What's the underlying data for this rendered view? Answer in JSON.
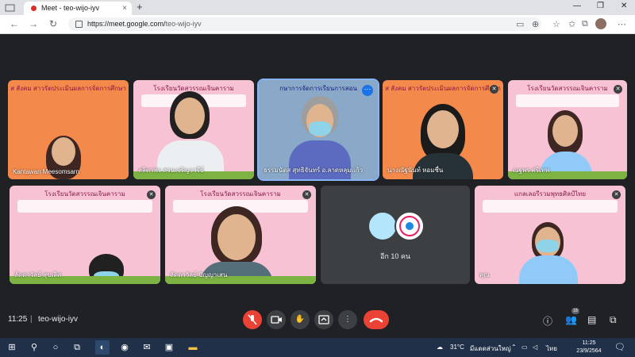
{
  "browser": {
    "tab_title": "Meet - teo-wijo-iyv",
    "new_tab_symbol": "+",
    "tab_close_symbol": "×",
    "url_host": "https://meet.google.com/",
    "url_path": "teo-wijo-iyv",
    "minimize_symbol": "—",
    "maximize_symbol": "❐",
    "close_symbol": "✕"
  },
  "tiles_top": [
    {
      "name": "Kantawan Meesomsarn",
      "slide_title": "ส สังคม สาวรัตประเมินผลการจัดการศึกษา"
    },
    {
      "name": "ลลิตาพร สวนเจริญวารีย์",
      "slide_title": "โรงเรียนวัดสวรรณเจินคาราม"
    },
    {
      "name": "ธรรมนัดส สุทธิจันทร์ อ.ลาดหลุมแก้ว",
      "slide_title": "กษาการจัดการเรียนการสอน"
    },
    {
      "name": "นางณัฐนันท์ หอมชื่น",
      "slide_title": "ส สังคม สาวรัตประเมินผลการจัดการศึกษา"
    },
    {
      "name": "ณฐพร ศรีเทพ",
      "slide_title": "โรงเรียนวัดสวรรณเจินคาราม"
    }
  ],
  "tiles_bottom": [
    {
      "name": "ลัดดาวัลย์ สุขเลิศ",
      "slide_title": "โรงเรียนวัดสวรรณเจินคาราม"
    },
    {
      "name": "ลัดดาวัลย์ ปัญญาเสน",
      "slide_title": "โรงเรียนวัดสวรรณเจินคาราม"
    },
    {
      "name": "",
      "more_label": "อีก 10 คน"
    },
    {
      "name": "คุณ",
      "slide_title": "แกลเลอรีรวมพุทธศิลป์ไทย"
    }
  ],
  "meeting": {
    "time": "11:25",
    "separator": "|",
    "code": "teo-wijo-iyv",
    "participant_count": "18"
  },
  "taskbar": {
    "temperature": "31°C",
    "weather_text": "มีแดดส่วนใหญ่",
    "language": "ไทย",
    "clock_time": "11:25",
    "clock_date": "23/9/2564"
  },
  "colors": {
    "meet_bg": "#202124",
    "end_call": "#ea4335",
    "active_outline": "#8ab4f8",
    "taskbar": "#1f3048"
  }
}
